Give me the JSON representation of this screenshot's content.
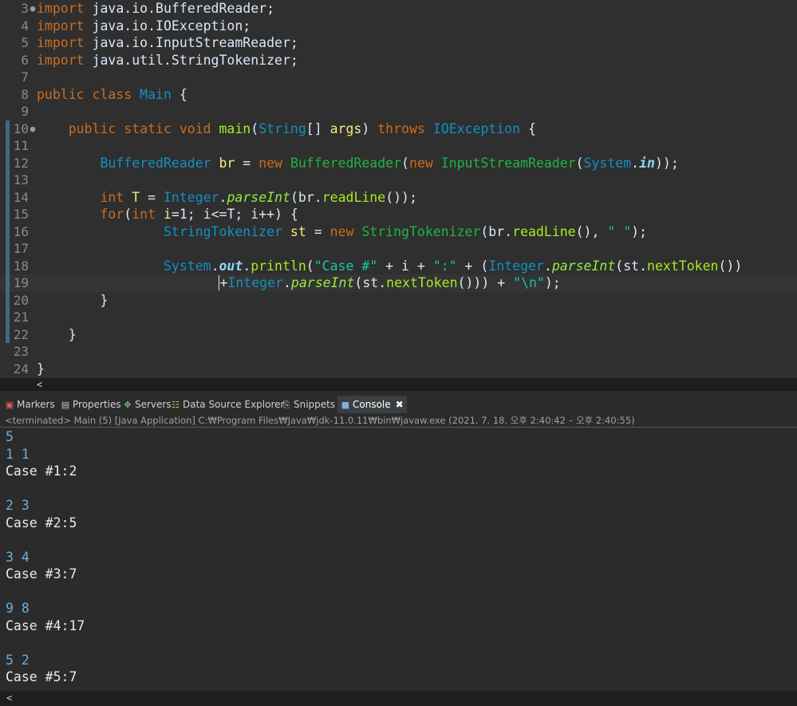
{
  "editor": {
    "lines": [
      {
        "n": "3",
        "fold": "●",
        "html": "<span class='kw'>import</span> java.io.BufferedReader;"
      },
      {
        "n": "4",
        "html": "<span class='kw'>import</span> java.io.IOException;"
      },
      {
        "n": "5",
        "html": "<span class='kw'>import</span> java.io.InputStreamReader;"
      },
      {
        "n": "6",
        "html": "<span class='kw'>import</span> java.util.StringTokenizer;"
      },
      {
        "n": "7",
        "html": ""
      },
      {
        "n": "8",
        "html": "<span class='kw'>public class</span> <span class='ty'>Main</span> {"
      },
      {
        "n": "9",
        "html": ""
      },
      {
        "n": "10",
        "fold": "●",
        "html": "    <span class='kw'>public static void</span> <span class='meth'>main</span>(<span class='ty'>String</span>[] <span class='var'>args</span>) <span class='kw'>throws</span> <span class='ty'>IOException</span> {"
      },
      {
        "n": "11",
        "html": ""
      },
      {
        "n": "12",
        "html": "        <span class='ty'>BufferedReader</span> <span class='var'>br</span> = <span class='kw'>new</span> <span class='cls'>BufferedReader</span>(<span class='kw'>new</span> <span class='cls'>InputStreamReader</span>(<span class='ty'>System</span>.<span class='fld'>in</span>));"
      },
      {
        "n": "13",
        "html": ""
      },
      {
        "n": "14",
        "html": "        <span class='kw'>int</span> <span class='var'>T</span> = <span class='ty'>Integer</span>.<span class='sti'>parseInt</span>(br.<span class='meth'>readLine</span>());"
      },
      {
        "n": "15",
        "html": "        <span class='kw'>for</span>(<span class='kw'>int</span> <span class='var'>i</span>=1; i&lt;=T; i++) {"
      },
      {
        "n": "16",
        "html": "                <span class='ty'>StringTokenizer</span> <span class='var'>st</span> = <span class='kw'>new</span> <span class='cls'>StringTokenizer</span>(br.<span class='meth'>readLine</span>(), <span class='str'>\" \"</span>);"
      },
      {
        "n": "17",
        "html": ""
      },
      {
        "n": "18",
        "html": "                <span class='ty'>System</span>.<span class='fld'>out</span>.<span class='meth'>println</span>(<span class='str'>\"Case #\"</span> + i + <span class='str'>\":\"</span> + (<span class='ty'>Integer</span>.<span class='sti'>parseInt</span>(st.<span class='meth'>nextToken</span>())"
      },
      {
        "n": "19",
        "current": true,
        "html": "                       <span class='cursor'></span>+<span class='ty'>Integer</span>.<span class='sti'>parseInt</span>(st.<span class='meth'>nextToken</span>())) + <span class='str'>\"\\n\"</span>);"
      },
      {
        "n": "20",
        "html": "        }"
      },
      {
        "n": "21",
        "html": ""
      },
      {
        "n": "22",
        "html": "    }"
      },
      {
        "n": "23",
        "html": ""
      },
      {
        "n": "24",
        "html": "}"
      }
    ],
    "scroll_arrow": "<"
  },
  "views": {
    "tabs": [
      {
        "name": "tab-markers",
        "icon": "▣",
        "icon_name": "markers-icon",
        "label": "Markers",
        "color": "#e05a5a"
      },
      {
        "name": "tab-properties",
        "icon": "▤",
        "icon_name": "properties-icon",
        "label": "Properties",
        "color": "#c8c8c8"
      },
      {
        "name": "tab-servers",
        "icon": "✥",
        "icon_name": "servers-icon",
        "label": "Servers",
        "color": "#6fc36f"
      },
      {
        "name": "tab-data-source-explorer",
        "icon": "☷",
        "icon_name": "data-source-explorer-icon",
        "label": "Data Source Explorer",
        "color": "#e0c05a"
      },
      {
        "name": "tab-snippets",
        "icon": "⎘",
        "icon_name": "snippets-icon",
        "label": "Snippets",
        "color": "#c8c8c8"
      },
      {
        "name": "tab-console",
        "icon": "■",
        "icon_name": "console-icon",
        "label": "Console",
        "color": "#7fb0e0",
        "active": true,
        "close": "✖"
      }
    ],
    "status": "<terminated> Main (5) [Java Application] C:₩Program Files₩Java₩jdk-11.0.11₩bin₩javaw.exe  (2021. 7. 18. 오후 2:40:42 – 오후 2:40:55)"
  },
  "console": {
    "lines": [
      {
        "text": "5",
        "kind": "input"
      },
      {
        "text": "1 1",
        "kind": "input"
      },
      {
        "text": "Case #1:2",
        "kind": "output"
      },
      {
        "text": "",
        "kind": "output"
      },
      {
        "text": "2 3",
        "kind": "input"
      },
      {
        "text": "Case #2:5",
        "kind": "output"
      },
      {
        "text": "",
        "kind": "output"
      },
      {
        "text": "3 4",
        "kind": "input"
      },
      {
        "text": "Case #3:7",
        "kind": "output"
      },
      {
        "text": "",
        "kind": "output"
      },
      {
        "text": "9 8",
        "kind": "input"
      },
      {
        "text": "Case #4:17",
        "kind": "output"
      },
      {
        "text": "",
        "kind": "output"
      },
      {
        "text": "5 2",
        "kind": "input"
      },
      {
        "text": "Case #5:7",
        "kind": "output"
      }
    ],
    "scroll_arrow": "<"
  }
}
